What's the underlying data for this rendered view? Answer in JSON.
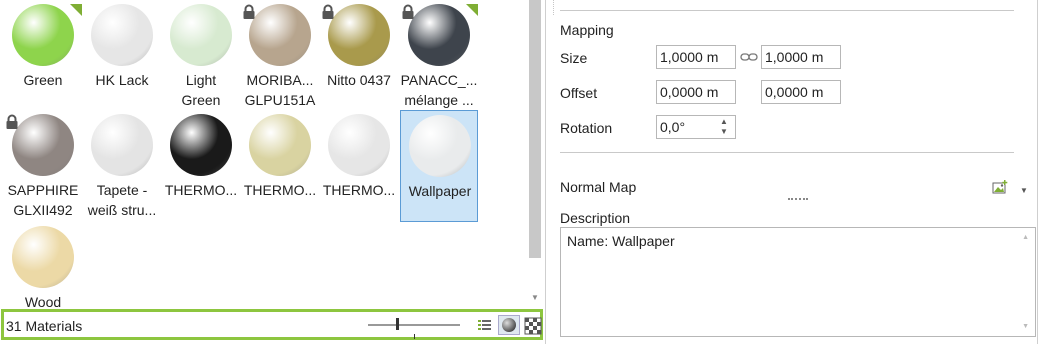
{
  "materials": [
    {
      "label": "Green",
      "color": "#8ed44c",
      "lock": false,
      "tri": true,
      "selected": false
    },
    {
      "label": "HK Lack",
      "color": "#e6e6e6",
      "lock": false,
      "tri": false,
      "selected": false
    },
    {
      "label": "Light\nGreen",
      "color": "#d7ead0",
      "lock": false,
      "tri": false,
      "selected": false
    },
    {
      "label": "MORIBA...\nGLPU151A",
      "color": "#b7a58e",
      "lock": true,
      "tri": false,
      "selected": false
    },
    {
      "label": "Nitto 0437",
      "color": "#a99a4c",
      "lock": true,
      "tri": false,
      "selected": false
    },
    {
      "label": "PANACC_...\nmélange ...",
      "color": "#3e444c",
      "lock": true,
      "tri": true,
      "selected": false
    },
    {
      "label": "SAPPHIRE\nGLXII492",
      "color": "#8f8682",
      "lock": true,
      "tri": false,
      "selected": false
    },
    {
      "label": "Tapete -\nweiß stru...",
      "color": "#e4e4e4",
      "lock": false,
      "tri": false,
      "selected": false
    },
    {
      "label": "THERMO...",
      "color": "#1a1a1a",
      "lock": false,
      "tri": false,
      "selected": false
    },
    {
      "label": "THERMO...",
      "color": "#d9d3a1",
      "lock": false,
      "tri": false,
      "selected": false
    },
    {
      "label": "THERMO...",
      "color": "#e6e6e6",
      "lock": false,
      "tri": false,
      "selected": false
    },
    {
      "label": "Wallpaper",
      "color": "#e9ebec",
      "lock": false,
      "tri": false,
      "selected": true
    },
    {
      "label": "Wood",
      "color": "#ecd9a6",
      "lock": false,
      "tri": false,
      "selected": false
    }
  ],
  "status": {
    "count_label": "31 Materials"
  },
  "mapping": {
    "title": "Mapping",
    "size_label": "Size",
    "size_x": "1,0000 m",
    "size_y": "1,0000 m",
    "offset_label": "Offset",
    "offset_x": "0,0000 m",
    "offset_y": "0,0000 m",
    "rotation_label": "Rotation",
    "rotation_value": "0,0°"
  },
  "normal_map": {
    "label": "Normal Map"
  },
  "description": {
    "label": "Description",
    "text": "Name: Wallpaper"
  },
  "colors": {
    "accent_green": "#8dc63f",
    "selection": "#cce4f7"
  }
}
